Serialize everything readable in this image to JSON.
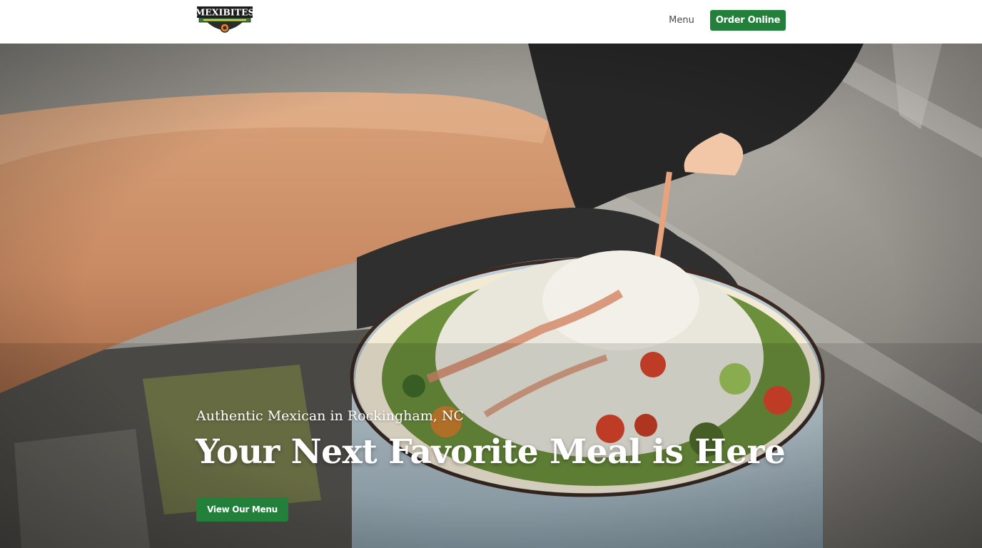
{
  "header": {
    "logo_text": "MEXIBITES",
    "nav": {
      "menu_label": "Menu"
    },
    "order_button_label": "Order Online"
  },
  "hero": {
    "subtitle": "Authentic Mexican in Rockingham, NC",
    "title": "Your Next Favorite Meal is Here",
    "cta_label": "View Our Menu"
  },
  "colors": {
    "brand_green": "#22803a",
    "header_bg": "#ffffff",
    "nav_text": "#4a4a4a"
  }
}
